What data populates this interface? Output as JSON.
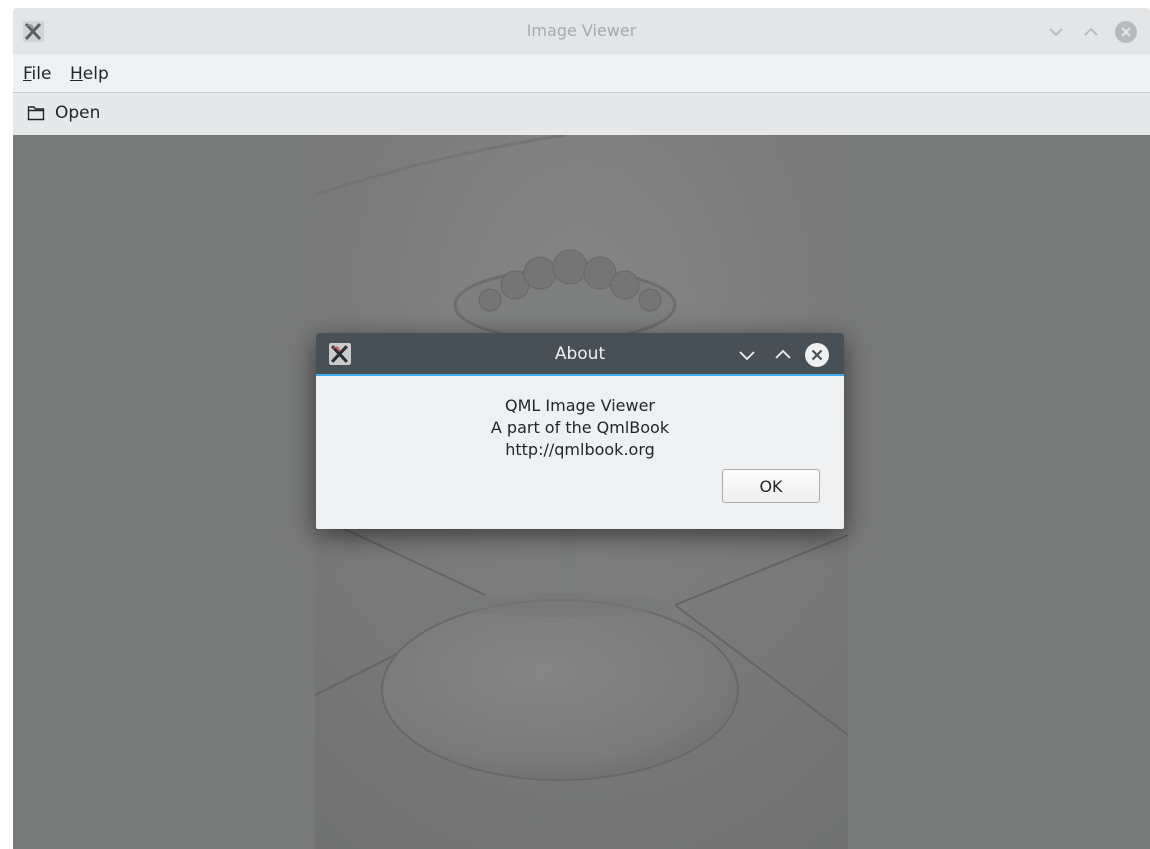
{
  "window": {
    "title": "Image Viewer",
    "buttons": [
      "minimize-icon",
      "maximize-icon",
      "close-icon"
    ]
  },
  "menubar": {
    "items": [
      {
        "mnemonic": "F",
        "rest": "ile"
      },
      {
        "mnemonic": "H",
        "rest": "elp"
      }
    ]
  },
  "toolbar": {
    "open_label": "Open",
    "open_icon": "folder-icon"
  },
  "dialog": {
    "title": "About",
    "lines": [
      "QML Image Viewer",
      "A part of the QmlBook",
      "http://qmlbook.org"
    ],
    "ok_label": "OK"
  },
  "colors": {
    "accent": "#3daee9",
    "dialog_titlebar": "#475057",
    "window_bg": "#eff0f1"
  }
}
